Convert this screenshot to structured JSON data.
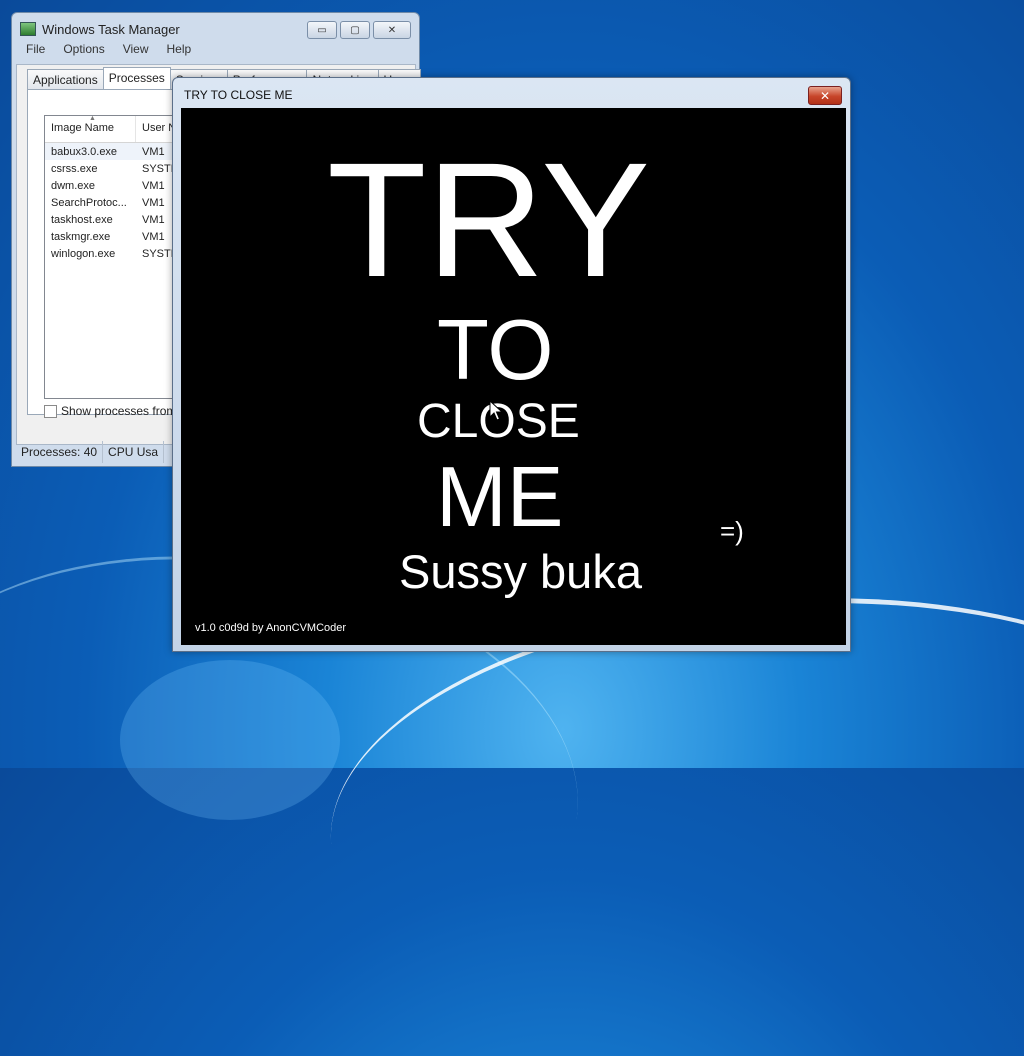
{
  "task_manager": {
    "title": "Windows Task Manager",
    "controls": {
      "minimize": "▭",
      "maximize": "▢",
      "close": "✕"
    },
    "menu": [
      "File",
      "Options",
      "View",
      "Help"
    ],
    "tabs": [
      "Applications",
      "Processes",
      "Services",
      "Performance",
      "Networking",
      "Users"
    ],
    "active_tab": "Processes",
    "columns": [
      "Image Name",
      "User Na"
    ],
    "processes": [
      {
        "name": "babux3.0.exe",
        "user": "VM1"
      },
      {
        "name": "csrss.exe",
        "user": "SYSTEM"
      },
      {
        "name": "dwm.exe",
        "user": "VM1"
      },
      {
        "name": "SearchProtoc...",
        "user": "VM1"
      },
      {
        "name": "taskhost.exe",
        "user": "VM1"
      },
      {
        "name": "taskmgr.exe",
        "user": "VM1"
      },
      {
        "name": "winlogon.exe",
        "user": "SYSTEM"
      }
    ],
    "show_all_label": "Show processes from all",
    "status": {
      "processes": "Processes: 40",
      "cpu": "CPU Usa"
    }
  },
  "prank_window": {
    "title": "TRY TO CLOSE ME",
    "close_glyph": "✕",
    "lines": {
      "try": "TRY",
      "to": "TO",
      "close": "CLOSE",
      "me": "ME",
      "sussy": "Sussy buka",
      "smile": "=)"
    },
    "version": "v1.0 c0d9d by AnonCVMCoder"
  },
  "colors": {
    "desktop": "#1a84d6",
    "close_button": "#c7452a",
    "prank_bg": "#000000"
  }
}
